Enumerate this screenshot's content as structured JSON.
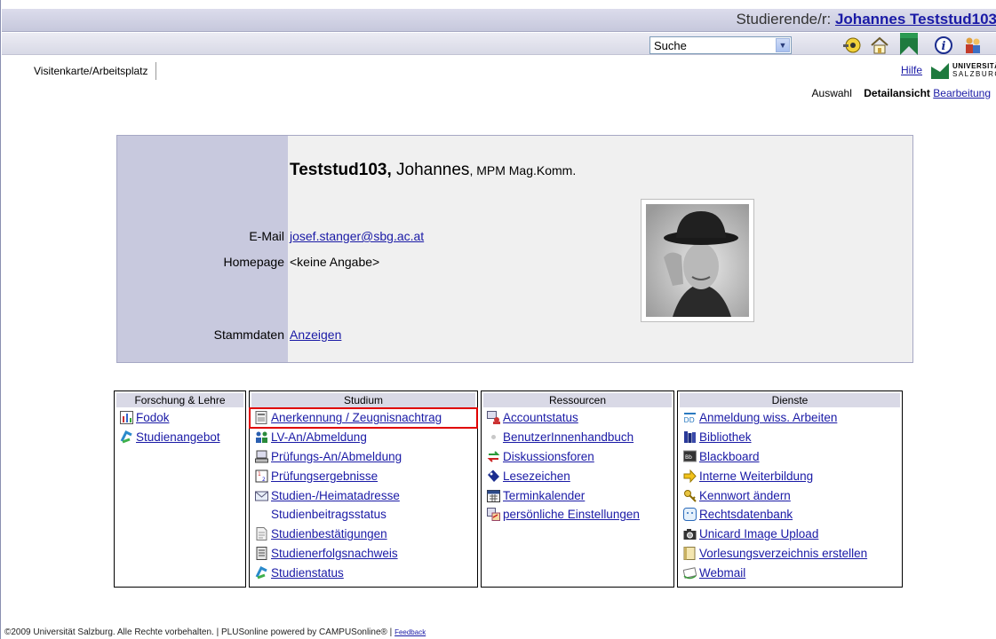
{
  "header": {
    "user_prefix": "Studierende/r:",
    "user_name": "Johannes Teststud103"
  },
  "toolbar": {
    "search_value": "Suche",
    "icons": [
      "key-icon",
      "home-icon",
      "bookmark-flag-icon",
      "info-icon",
      "people-icon"
    ]
  },
  "tabs": {
    "visitenkarte": "Visitenkarte/Arbeitsplatz",
    "hilfe": "Hilfe"
  },
  "logo": {
    "line1": "UNIVERSITÄT",
    "line2": "SALZBURG"
  },
  "viewmodes": {
    "auswahl": "Auswahl",
    "detail": "Detailansicht",
    "bearbeitung": "Bearbeitung"
  },
  "person": {
    "last_name": "Teststud103,",
    "first_name": "Johannes",
    "title": "MPM Mag.Komm.",
    "email_label": "E-Mail",
    "email": "josef.stanger@sbg.ac.at",
    "homepage_label": "Homepage",
    "homepage": "<keine Angabe>",
    "stammdaten_label": "Stammdaten",
    "stammdaten_link": "Anzeigen"
  },
  "menu": {
    "forschung": {
      "title": "Forschung & Lehre",
      "items": [
        "Fodok",
        "Studienangebot"
      ]
    },
    "studium": {
      "title": "Studium",
      "items": [
        "Anerkennung / Zeugnisnachtrag",
        "LV-An/Abmeldung",
        "Prüfungs-An/Abmeldung",
        "Prüfungsergebnisse",
        "Studien-/Heimatadresse",
        "Studienbeitragsstatus",
        "Studienbestätigungen",
        "Studienerfolgsnachweis",
        "Studienstatus"
      ]
    },
    "ressourcen": {
      "title": "Ressourcen",
      "items": [
        "Accountstatus",
        "BenutzerInnenhandbuch",
        "Diskussionsforen",
        "Lesezeichen",
        "Terminkalender",
        "persönliche Einstellungen"
      ]
    },
    "dienste": {
      "title": "Dienste",
      "items": [
        "Anmeldung wiss. Arbeiten",
        "Bibliothek",
        "Blackboard",
        "Interne Weiterbildung",
        "Kennwort ändern",
        "Rechtsdatenbank",
        "Unicard Image Upload",
        "Vorlesungsverzeichnis erstellen",
        "Webmail"
      ]
    }
  },
  "footer": {
    "text": "©2009 Universität Salzburg. Alle Rechte vorbehalten. | PLUSonline powered by CAMPUSonline® |",
    "feedback": "Feedback"
  },
  "colors": {
    "link": "#1a1aa6",
    "header_bg": "#c6c8dc",
    "card_left": "#c8c9de",
    "highlight": "#e00000",
    "logo_green": "#1e7a3e"
  }
}
